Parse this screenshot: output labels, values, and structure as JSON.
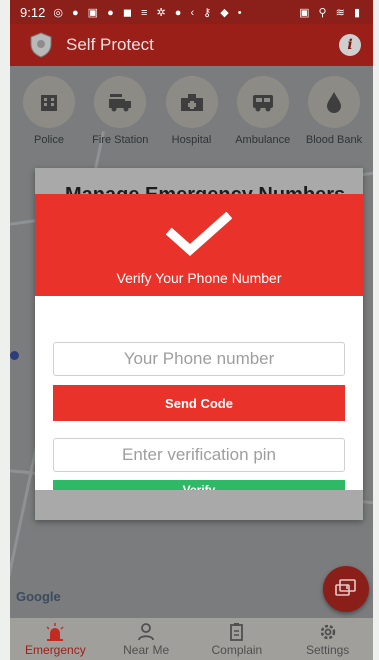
{
  "status_bar": {
    "time": "9:12",
    "left_icons": "◎ ● ▣ ● ◼ ≡ ✲ ● ‹ ⚷ ◆ •",
    "right_icons": "▣ ⚲ ≋ ▮"
  },
  "app_bar": {
    "title": "Self Protect",
    "info_label": "i",
    "logo_icon": "shield-icon"
  },
  "services": [
    {
      "label": "Police",
      "icon": "police-building-icon"
    },
    {
      "label": "Fire Station",
      "icon": "fire-truck-icon"
    },
    {
      "label": "Hospital",
      "icon": "hospital-icon"
    },
    {
      "label": "Ambulance",
      "icon": "ambulance-icon"
    },
    {
      "label": "Blood Bank",
      "icon": "blood-drop-icon"
    }
  ],
  "background_card": {
    "title": "Manage Emergency Numbers"
  },
  "dialog": {
    "title": "Verify Your Phone Number",
    "phone_placeholder": "Your Phone number",
    "send_code_label": "Send Code",
    "pin_placeholder": "Enter verification pin",
    "verify_label": "Verify"
  },
  "map": {
    "attribution": "Google"
  },
  "bottom_nav": [
    {
      "label": "Emergency",
      "icon": "siren-icon",
      "active": true
    },
    {
      "label": "Near Me",
      "icon": "person-pin-icon",
      "active": false
    },
    {
      "label": "Complain",
      "icon": "clipboard-edit-icon",
      "active": false
    },
    {
      "label": "Settings",
      "icon": "gear-icon",
      "active": false
    }
  ],
  "colors": {
    "primary_red": "#e8322a",
    "dark_red": "#9a1f19",
    "verify_green": "#2fb866"
  }
}
